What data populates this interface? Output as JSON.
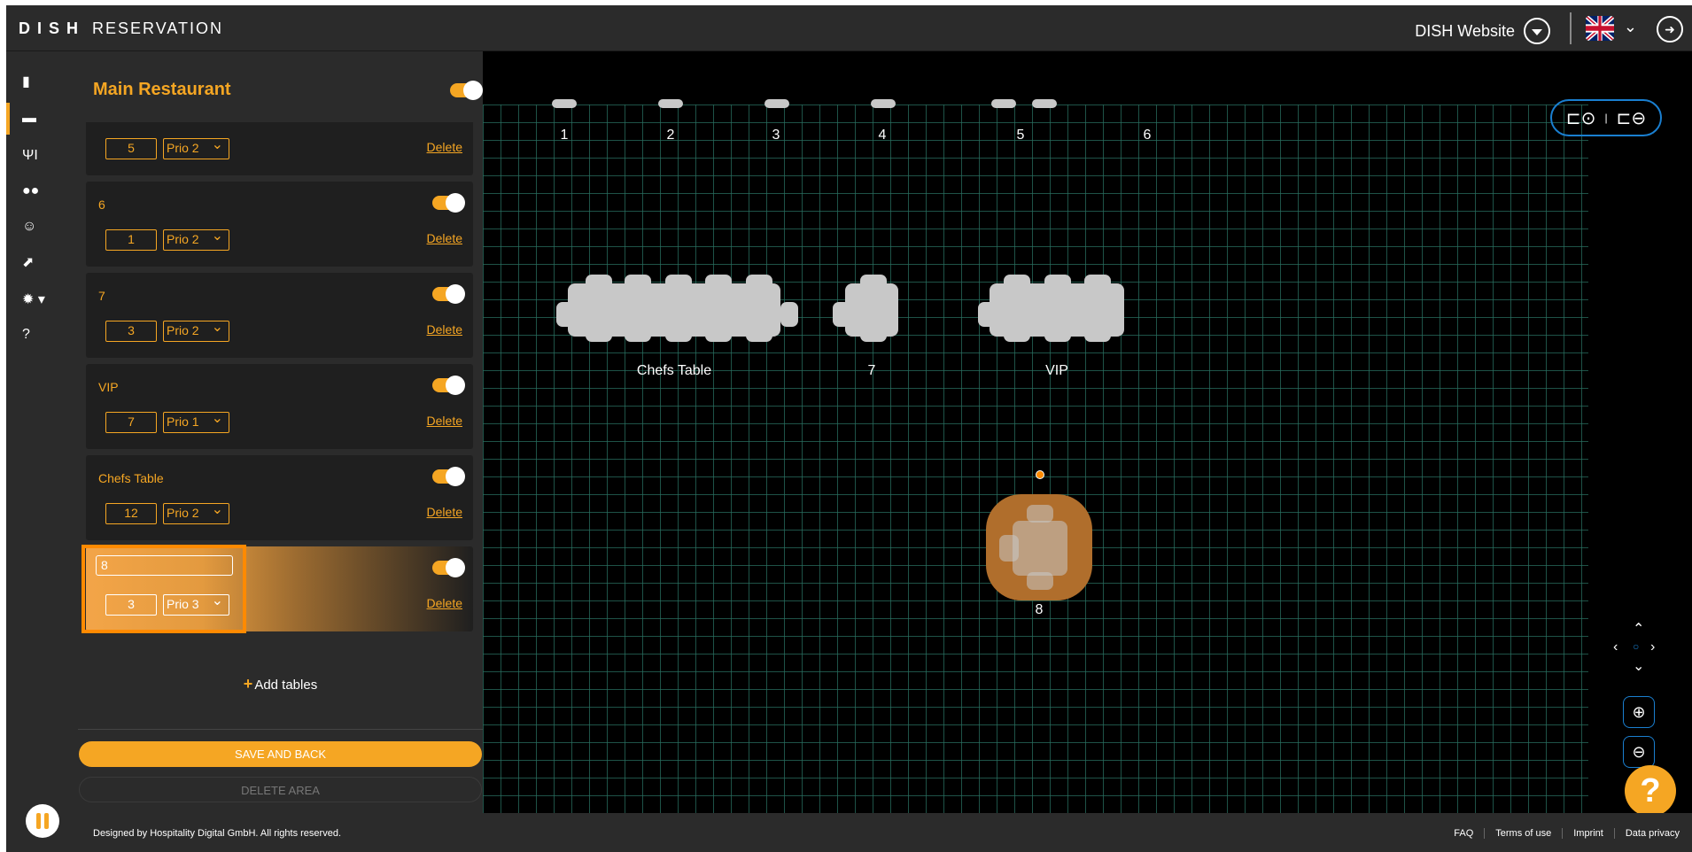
{
  "brand": {
    "left": "DISH",
    "right": "RESERVATION"
  },
  "header": {
    "website_link": "DISH Website",
    "language_icon": "uk-flag-icon",
    "logout_icon": "logout-icon"
  },
  "rail": {
    "items": [
      {
        "icon": "reservations-book-icon"
      },
      {
        "icon": "table-icon"
      },
      {
        "icon": "menu-cutlery-icon"
      },
      {
        "icon": "guests-icon"
      },
      {
        "icon": "feedback-smiley-icon"
      },
      {
        "icon": "reports-chart-icon"
      },
      {
        "icon": "settings-gear-icon"
      },
      {
        "icon": "help-circle-icon"
      }
    ],
    "pause_icon": "pause-icon"
  },
  "panel": {
    "title": "Main Restaurant",
    "tables": [
      {
        "name": "5",
        "seats": "5",
        "priority": "Prio 2",
        "delete_label": "Delete",
        "enabled": true
      },
      {
        "name": "6",
        "seats": "1",
        "priority": "Prio 2",
        "delete_label": "Delete",
        "enabled": true
      },
      {
        "name": "7",
        "seats": "3",
        "priority": "Prio 2",
        "delete_label": "Delete",
        "enabled": true
      },
      {
        "name": "VIP",
        "seats": "7",
        "priority": "Prio 1",
        "delete_label": "Delete",
        "enabled": true
      },
      {
        "name": "Chefs Table",
        "seats": "12",
        "priority": "Prio 2",
        "delete_label": "Delete",
        "enabled": true
      },
      {
        "name": "8",
        "seats": "3",
        "priority": "Prio 3",
        "delete_label": "Delete",
        "enabled": true
      }
    ],
    "add_tables_label": "Add tables",
    "save_label": "SAVE AND BACK",
    "delete_area_label": "DELETE AREA"
  },
  "floor": {
    "column_labels": [
      "1",
      "2",
      "3",
      "4",
      "5",
      "6"
    ],
    "table_labels": {
      "chefs": "Chefs Table",
      "seven": "7",
      "vip": "VIP",
      "eight": "8"
    }
  },
  "footer": {
    "copyright": "Designed by Hospitality Digital GmbH. All rights reserved.",
    "links": [
      "FAQ",
      "Terms of use",
      "Imprint",
      "Data privacy"
    ]
  },
  "colors": {
    "accent": "#f5a623",
    "background": "#000000",
    "panel": "#2b2b2b",
    "grid": "#286e5f",
    "control_border": "#1a7fd0"
  }
}
